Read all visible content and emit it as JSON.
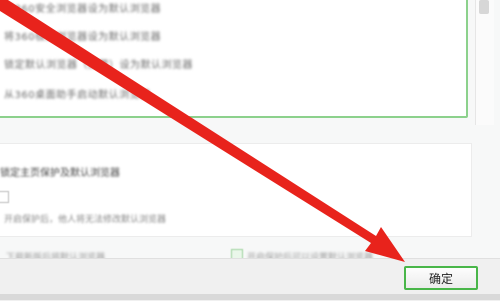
{
  "dialog": {
    "confirm_label": "确定"
  },
  "options": {
    "lines": [
      "将360安全浏览器设为默认浏览器",
      "将360极速浏览器设为默认浏览器",
      "锁定默认浏览器（推荐）设为默认浏览器",
      "从360桌面助手启动默认浏览器"
    ]
  },
  "protection": {
    "title": "锁定主页保护及默认浏览器",
    "description": "开启保护后，他人将无法修改默认浏览器",
    "bottom_left": "下载新版后将默认浏览器",
    "bottom_right": "开启保护后可以设置默认浏览器"
  },
  "annotation": {
    "color": "#e8231c"
  }
}
